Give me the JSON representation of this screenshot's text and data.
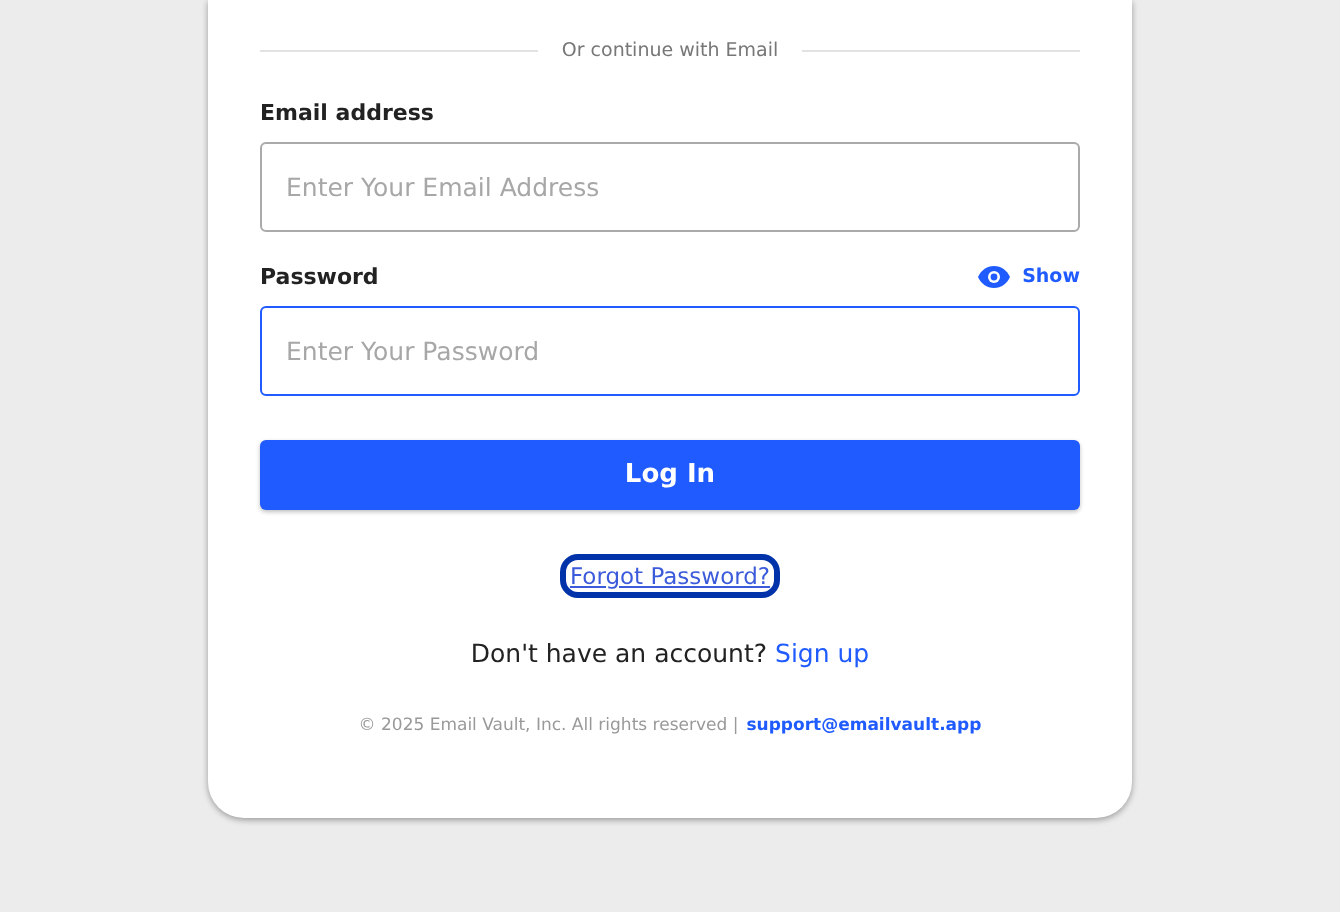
{
  "divider": "Or continue with Email",
  "fields": [
    {
      "label": "Email address",
      "placeholder": "Enter Your Email Address",
      "focused": false
    },
    {
      "label": "Password",
      "placeholder": "Enter Your Password",
      "focused": true,
      "toggle": "Show"
    }
  ],
  "login_button": "Log In",
  "forgot_link": {
    "text": "Forgot Password?",
    "focused": true
  },
  "signup": {
    "prompt": "Don't have an account?",
    "link": "Sign up"
  },
  "footer": {
    "copyright": "© 2025 Email Vault, Inc. All rights reserved |",
    "email": "support@emailvault.app"
  }
}
